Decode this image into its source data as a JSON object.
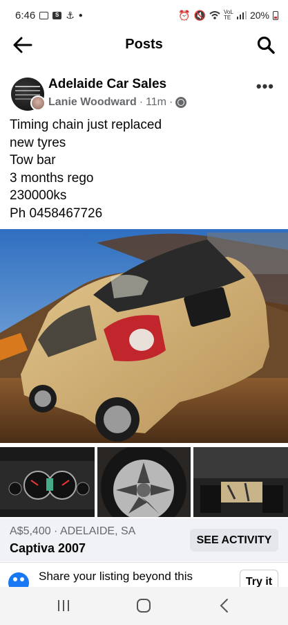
{
  "status_bar": {
    "time": "6:46",
    "battery": "20%",
    "network": "VoLTE"
  },
  "header": {
    "title": "Posts",
    "back_icon": "arrow-left-icon",
    "search_icon": "search-icon"
  },
  "post": {
    "group_name": "Adelaide Car Sales",
    "author": "Lanie Woodward",
    "time_ago": "11m",
    "separator": "·",
    "privacy_icon": "globe-icon",
    "more_icon": "more-horizontal-icon",
    "more_label": "•••",
    "text_lines": [
      "Timing chain just replaced",
      "new tyres",
      "Tow bar",
      "3 months rego",
      "230000ks",
      "Ph 0458467726"
    ]
  },
  "listing": {
    "price_location": "A$5,400 · ADELAIDE, SA",
    "title": "Captiva 2007",
    "action_label": "SEE ACTIVITY"
  },
  "share": {
    "text": "Share your listing beyond this",
    "button_label": "Try it"
  },
  "nav": {
    "recent_icon": "recent-apps-icon",
    "home_icon": "home-icon",
    "back_icon": "back-chevron-icon"
  },
  "colors": {
    "accent": "#1877f2",
    "secondary_text": "#65676b",
    "listing_bg": "#f0f2f5",
    "button_bg": "#e4e6eb"
  }
}
